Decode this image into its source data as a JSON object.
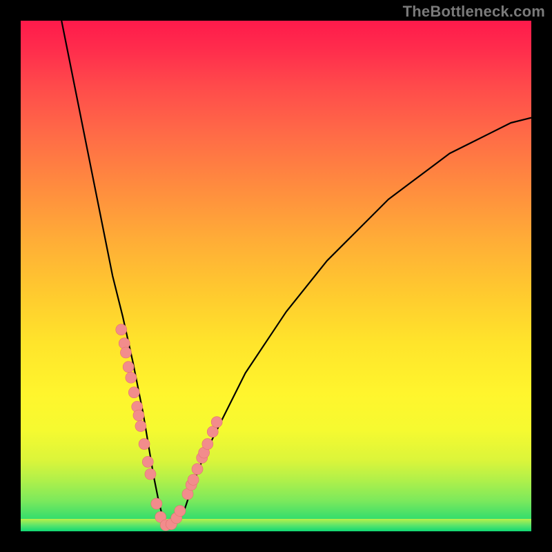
{
  "watermark": "TheBottleneck.com",
  "colors": {
    "curve": "#000000",
    "dot_fill": "#f28c8c",
    "dot_stroke": "#e37070"
  },
  "chart_data": {
    "type": "line",
    "title": "",
    "xlabel": "",
    "ylabel": "",
    "xlim": [
      0,
      100
    ],
    "ylim": [
      0,
      100
    ],
    "grid": false,
    "legend": false,
    "annotations": [],
    "comment": "Stylized bottleneck V-shape curve over a red→green vertical gradient. No numeric axes or labels are displayed; the x and y units are unlabeled percentages of the plot area. The curve descends steeply from upper-left, reaches ~0 near x≈28, then rises with decreasing slope toward the right edge (around y≈81 at x=100). The 'dots' series are highlighted sample points clustered around the bottom of the V on both flanks.",
    "series": [
      {
        "name": "curve",
        "kind": "line",
        "x": [
          8,
          10,
          12,
          14,
          16,
          18,
          20,
          22,
          24,
          26,
          27,
          28,
          29,
          30,
          32,
          34,
          36,
          38,
          40,
          44,
          48,
          52,
          56,
          60,
          64,
          68,
          72,
          76,
          80,
          84,
          88,
          92,
          96,
          100
        ],
        "y": [
          100,
          90,
          80,
          70,
          60,
          50,
          42,
          33,
          23,
          11,
          6,
          2,
          1,
          1,
          4,
          10,
          15,
          19,
          23,
          31,
          37,
          43,
          48,
          53,
          57,
          61,
          65,
          68,
          71,
          74,
          76,
          78,
          80,
          81
        ]
      },
      {
        "name": "dots",
        "kind": "scatter",
        "x": [
          19.7,
          20.3,
          20.6,
          21.1,
          21.6,
          22.2,
          22.8,
          23.1,
          23.5,
          24.2,
          24.9,
          25.4,
          26.6,
          27.4,
          28.4,
          29.5,
          30.5,
          31.2,
          32.7,
          33.4,
          33.8,
          34.6,
          35.5,
          35.9,
          36.6,
          37.6,
          38.4
        ],
        "y": [
          39.5,
          36.8,
          35.0,
          32.2,
          30.1,
          27.2,
          24.4,
          22.7,
          20.6,
          17.1,
          13.6,
          11.2,
          5.4,
          2.8,
          1.2,
          1.4,
          2.6,
          4.0,
          7.3,
          9.1,
          10.1,
          12.2,
          14.4,
          15.4,
          17.1,
          19.5,
          21.4
        ]
      }
    ]
  }
}
